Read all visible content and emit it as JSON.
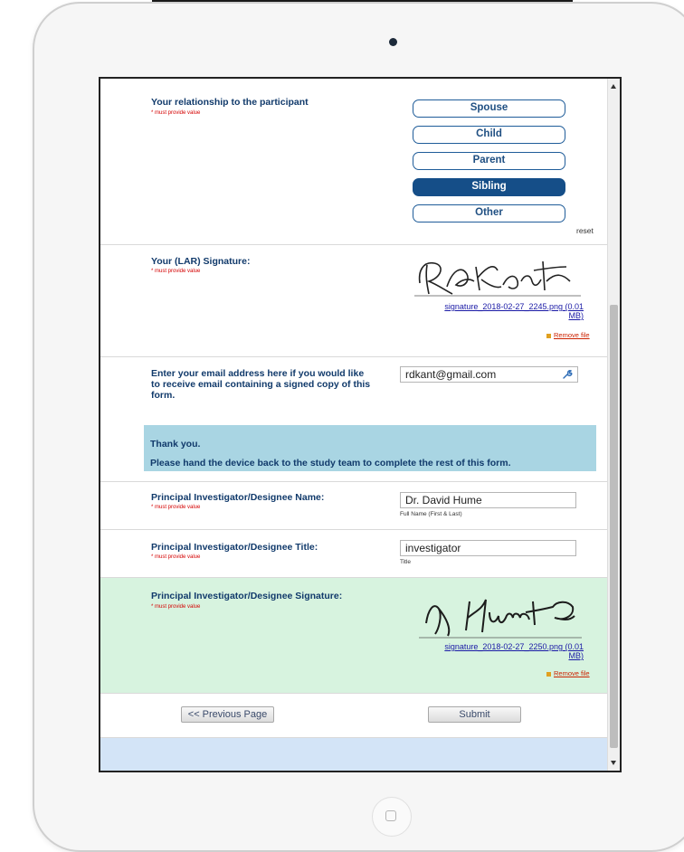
{
  "relationship": {
    "label": "Your relationship to the participant",
    "required": "* must provide value",
    "options": [
      "Spouse",
      "Child",
      "Parent",
      "Sibling",
      "Other"
    ],
    "selected": "Sibling",
    "reset": "reset"
  },
  "lar_signature": {
    "label": "Your (LAR) Signature:",
    "required": "* must provide value",
    "file_line1": "signature_2018-02-27_2245.png (0.01",
    "file_line2": "MB)",
    "remove": "Remove file"
  },
  "email": {
    "label_line1": "Enter your email address here if you would like",
    "label_line2": "to receive email containing a signed copy of this",
    "label_line3": "form.",
    "value": "rdkant@gmail.com"
  },
  "notice": {
    "line1": "Thank you.",
    "line2": "Please hand the device back to the study team to complete the rest of this form."
  },
  "pi_name": {
    "label": "Principal Investigator/Designee Name:",
    "required": "* must provide value",
    "value": "Dr. David Hume",
    "note": "Full Name (First & Last)"
  },
  "pi_title": {
    "label": "Principal Investigator/Designee Title:",
    "required": "* must provide value",
    "value": "investigator",
    "note": "Title"
  },
  "pi_signature": {
    "label": "Principal Investigator/Designee Signature:",
    "required": "* must provide value",
    "file_line1": "signature_2018-02-27_2250.png (0.01",
    "file_line2": "MB)",
    "remove": "Remove file"
  },
  "nav": {
    "previous": "<< Previous Page",
    "submit": "Submit"
  },
  "colors": {
    "selected": "#154e88",
    "notice_bg": "#a9d5e3",
    "highlight_bg": "#d7f3df",
    "footer_bg": "#d3e4f7"
  }
}
